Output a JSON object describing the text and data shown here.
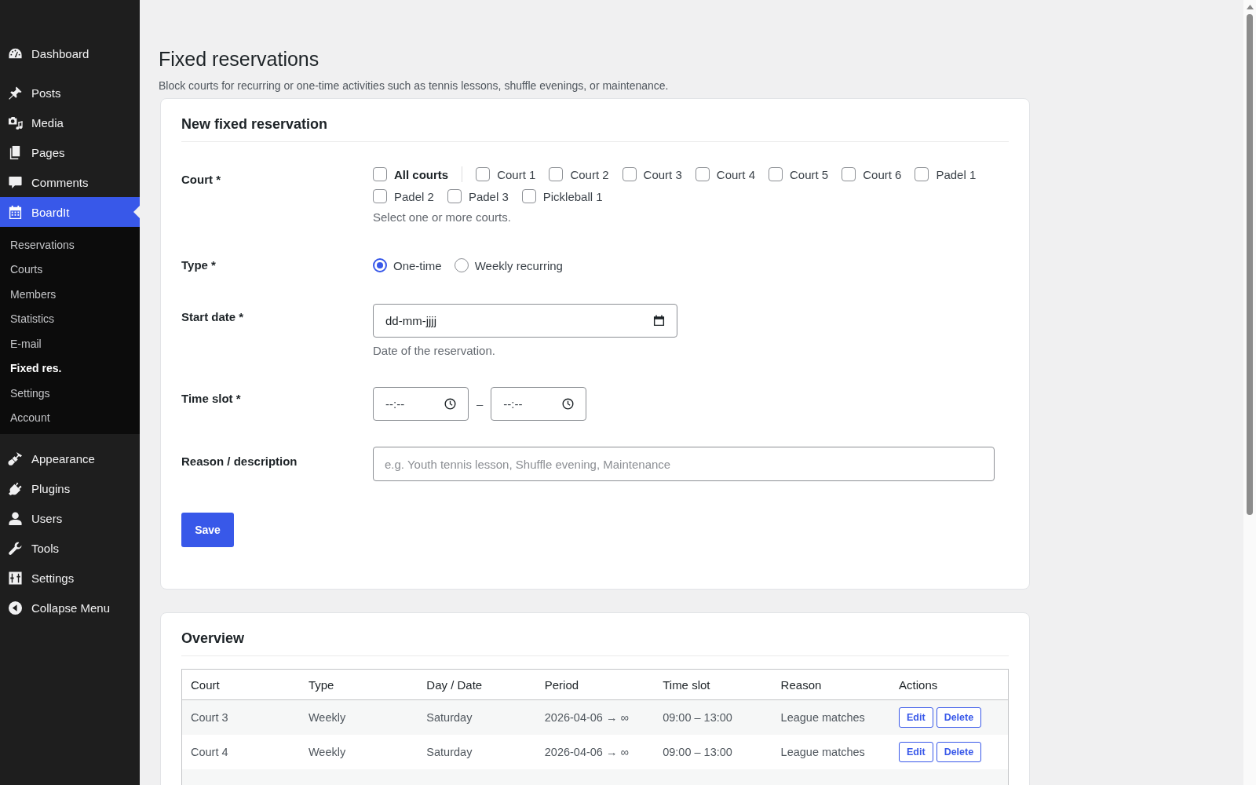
{
  "sidebar": {
    "groups": [
      {
        "items": [
          {
            "label": "Dashboard",
            "selected": false
          }
        ]
      },
      {
        "items": [
          {
            "label": "Posts",
            "selected": false
          },
          {
            "label": "Media",
            "selected": false
          },
          {
            "label": "Pages",
            "selected": false
          },
          {
            "label": "Comments",
            "selected": false
          },
          {
            "label": "BoardIt",
            "selected": true,
            "children": [
              {
                "label": "Reservations",
                "selected": false
              },
              {
                "label": "Courts",
                "selected": false
              },
              {
                "label": "Members",
                "selected": false
              },
              {
                "label": "Statistics",
                "selected": false
              },
              {
                "label": "E-mail",
                "selected": false
              },
              {
                "label": "Fixed res.",
                "selected": true
              },
              {
                "label": "Settings",
                "selected": false
              },
              {
                "label": "Account",
                "selected": false
              }
            ]
          }
        ]
      },
      {
        "items": [
          {
            "label": "Appearance",
            "selected": false
          },
          {
            "label": "Plugins",
            "selected": false
          },
          {
            "label": "Users",
            "selected": false
          },
          {
            "label": "Tools",
            "selected": false
          },
          {
            "label": "Settings",
            "selected": false
          }
        ]
      }
    ],
    "collapse": {
      "label": "Collapse Menu"
    }
  },
  "page": {
    "title": "Fixed reservations",
    "description": "Block courts for recurring or one-time activities such as tennis lessons, shuffle evenings, or maintenance."
  },
  "form": {
    "title": "New fixed reservation",
    "court": {
      "label": "Court *",
      "all": {
        "label": "All courts",
        "checked": false
      },
      "options": [
        {
          "label": "Court 1",
          "checked": false
        },
        {
          "label": "Court 2",
          "checked": false
        },
        {
          "label": "Court 3",
          "checked": false
        },
        {
          "label": "Court 4",
          "checked": false
        },
        {
          "label": "Court 5",
          "checked": false
        },
        {
          "label": "Court 6",
          "checked": false
        },
        {
          "label": "Padel 1",
          "checked": false
        },
        {
          "label": "Padel 2",
          "checked": false
        },
        {
          "label": "Padel 3",
          "checked": false
        },
        {
          "label": "Pickleball 1",
          "checked": false
        }
      ],
      "hint": "Select one or more courts."
    },
    "type": {
      "label": "Type *",
      "options": [
        {
          "label": "One-time",
          "selected": true
        },
        {
          "label": "Weekly recurring",
          "selected": false
        }
      ]
    },
    "start_date": {
      "label": "Start date *",
      "placeholder": "dd-mm-jjjj",
      "hint": "Date of the reservation."
    },
    "time_slot": {
      "label": "Time slot *",
      "from": {
        "placeholder": "--:--"
      },
      "separator": "–",
      "to": {
        "placeholder": "--:--"
      }
    },
    "reason": {
      "label": "Reason / description",
      "placeholder": "e.g. Youth tennis lesson, Shuffle evening, Maintenance"
    },
    "save": "Save"
  },
  "overview": {
    "title": "Overview",
    "table": {
      "columns": [
        "Court",
        "Type",
        "Day / Date",
        "Period",
        "Time slot",
        "Reason",
        "Actions"
      ],
      "rows": [
        {
          "cells": [
            "Court 3",
            "Weekly",
            "Saturday",
            "2026-04-06 → ∞",
            "09:00 – 13:00",
            "League matches"
          ],
          "actions": [
            "Edit",
            "Delete"
          ]
        },
        {
          "cells": [
            "Court 4",
            "Weekly",
            "Saturday",
            "2026-04-06 → ∞",
            "09:00 – 13:00",
            "League matches"
          ],
          "actions": [
            "Edit",
            "Delete"
          ]
        }
      ]
    }
  }
}
